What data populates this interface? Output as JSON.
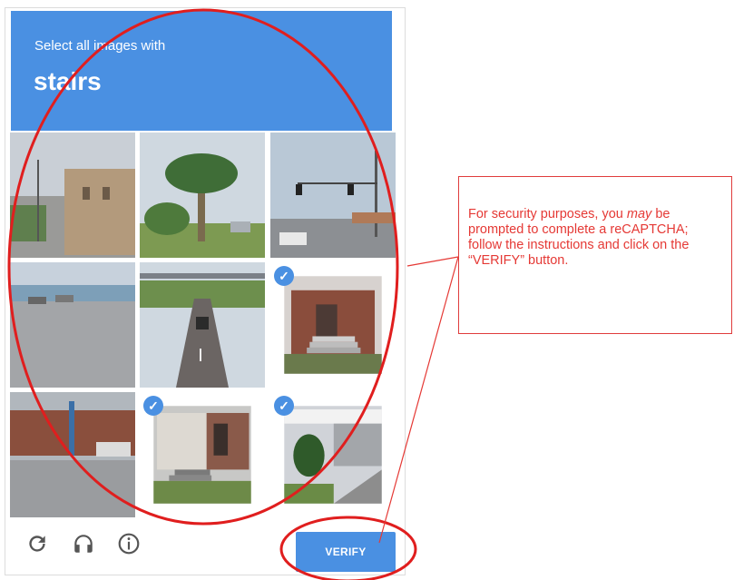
{
  "captcha": {
    "prompt": "Select all images with",
    "keyword": "stairs",
    "tiles": [
      {
        "scene": "street with building",
        "selected": false
      },
      {
        "scene": "palm tree street",
        "selected": false
      },
      {
        "scene": "traffic light intersection",
        "selected": false
      },
      {
        "scene": "parking lot road",
        "selected": false
      },
      {
        "scene": "highway",
        "selected": false
      },
      {
        "scene": "house porch stairs",
        "selected": true
      },
      {
        "scene": "road with car",
        "selected": false
      },
      {
        "scene": "house side stairs",
        "selected": true
      },
      {
        "scene": "porch stairs with bush",
        "selected": true
      }
    ],
    "footer": {
      "reload_icon": "reload-icon",
      "audio_icon": "headphones-icon",
      "info_icon": "info-icon",
      "verify_label": "VERIFY"
    },
    "accent_color": "#4a90e2"
  },
  "annotation": {
    "text_before": "For security purposes, you ",
    "text_emphasis": "may",
    "text_after": " be prompted to complete a reCAPTCHA; follow the instructions and click on the “VERIFY” button.",
    "color": "#e53935"
  }
}
